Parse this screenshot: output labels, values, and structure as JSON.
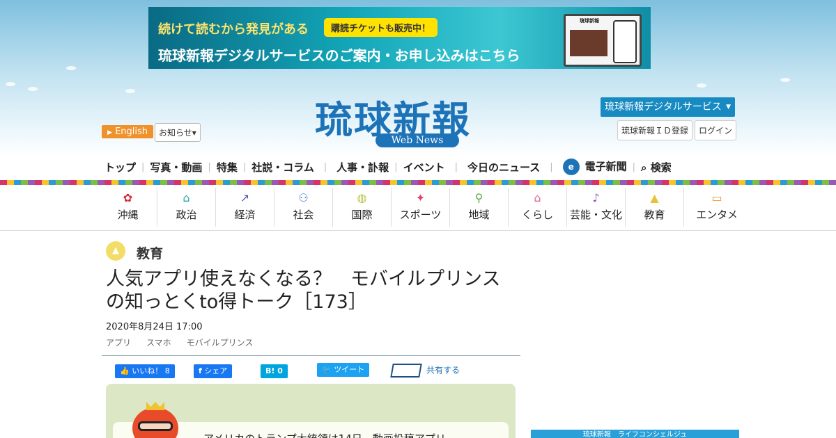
{
  "banner": {
    "line1": "続けて読むから発見がある",
    "badge": "購読チケットも販売中！",
    "line2": "琉球新報デジタルサービスのご案内・お申し込みはこちら",
    "device_label": "琉球新報"
  },
  "logo": {
    "title": "琉球新報",
    "subtitle": "Web News"
  },
  "header_left": {
    "english": "English",
    "notice": "お知らせ▾"
  },
  "header_right": {
    "digital": "琉球新報デジタルサービス",
    "id_register": "琉球新報ＩＤ登録",
    "login": "ログイン"
  },
  "main_nav": {
    "items": [
      "トップ",
      "写真・動画",
      "特集",
      "社説・コラム",
      "人事・訃報",
      "イベント",
      "今日のニュース"
    ],
    "e_paper": "電子新聞",
    "e_icon": "e",
    "search": "検索"
  },
  "categories": [
    {
      "label": "沖縄",
      "icon": "✿",
      "color": "#d62d3a"
    },
    {
      "label": "政治",
      "icon": "⌂",
      "color": "#2aa7a0"
    },
    {
      "label": "経済",
      "icon": "↗",
      "color": "#4a5aa8"
    },
    {
      "label": "社会",
      "icon": "⚇",
      "color": "#4a88c8"
    },
    {
      "label": "国際",
      "icon": "◍",
      "color": "#b7c23a"
    },
    {
      "label": "スポーツ",
      "icon": "✦",
      "color": "#e0446a"
    },
    {
      "label": "地域",
      "icon": "⚲",
      "color": "#5aab45"
    },
    {
      "label": "くらし",
      "icon": "⌂",
      "color": "#e06a8a"
    },
    {
      "label": "芸能・文化",
      "icon": "♪",
      "color": "#8d4bb0"
    },
    {
      "label": "教育",
      "icon": "▲",
      "color": "#e8c23a"
    },
    {
      "label": "エンタメ",
      "icon": "▭",
      "color": "#f0922c"
    }
  ],
  "article": {
    "section": "教育",
    "headline": "人気アプリ使えなくなる？　モバイルプリンスの知っとくto得トーク［173］",
    "date": "2020年8月24日 17:00",
    "tags": [
      "アプリ",
      "スマホ",
      "モバイルプリンス"
    ],
    "body_start": "アメリカのトランプ大統領は14日、動画投稿アプリ"
  },
  "share": {
    "like": "いいね！ 8",
    "fb_share": "シェア",
    "hatena": "B! 0",
    "tweet": "ツイート",
    "share_label": "共有する"
  },
  "sidebar_ad": {
    "text": "琉球新報　ライフコンシェルジュ"
  },
  "colors": {
    "brand": "#1d73b8",
    "english_btn": "#f0922c",
    "digital_btn": "#178ac1"
  }
}
